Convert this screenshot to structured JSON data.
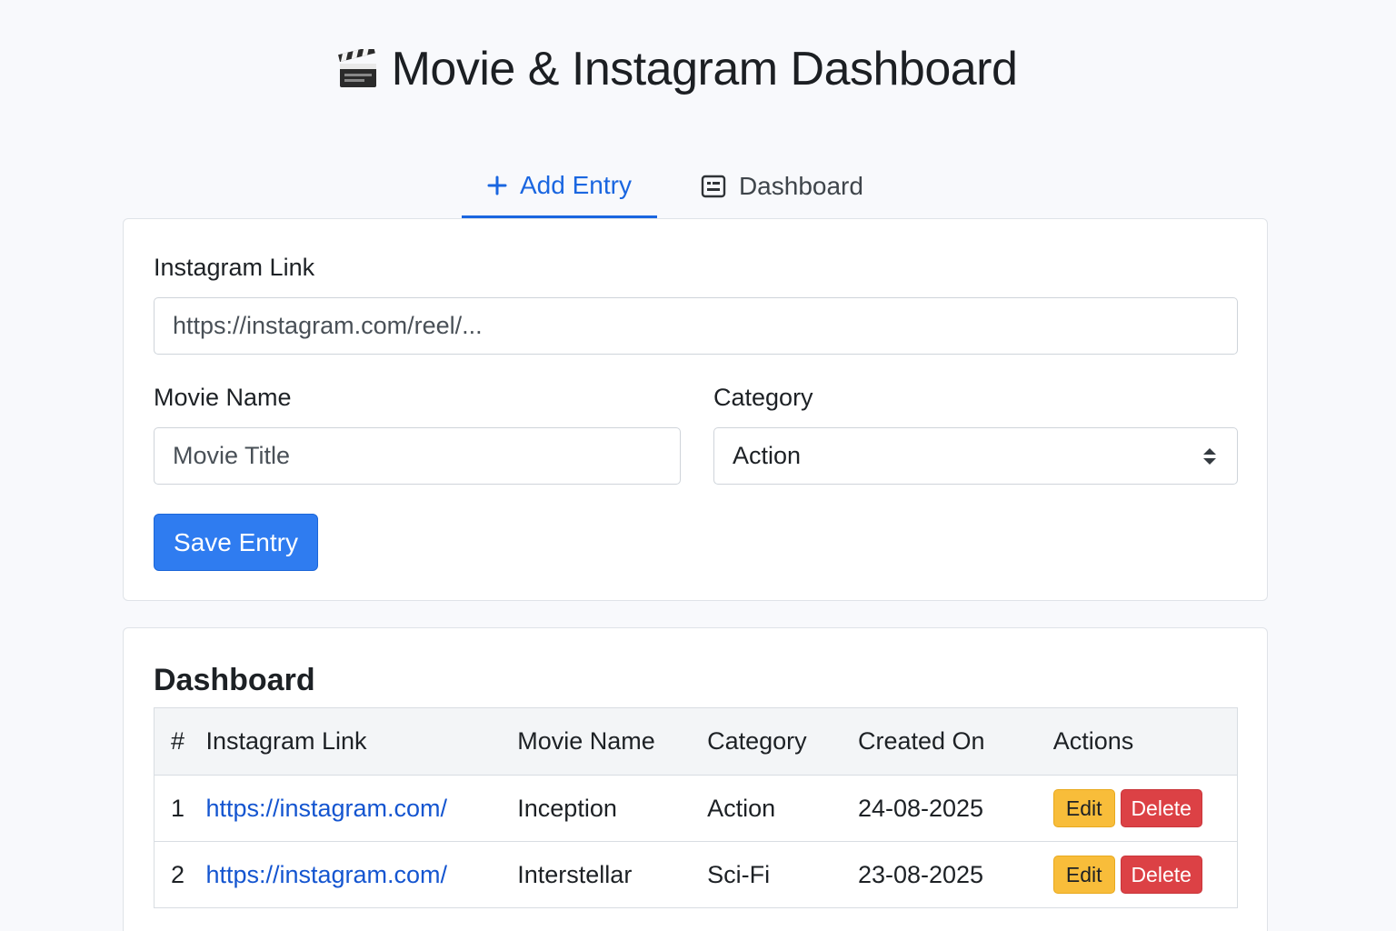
{
  "app": {
    "title": "Movie & Instagram Dashboard",
    "title_icon": "clapperboard-icon"
  },
  "tabs": [
    {
      "label": "Add Entry",
      "icon": "plus-icon",
      "active": true
    },
    {
      "label": "Dashboard",
      "icon": "dashboard-list-icon",
      "active": false
    }
  ],
  "form": {
    "instagram_label": "Instagram Link",
    "instagram_placeholder": "https://instagram.com/reel/...",
    "movie_label": "Movie Name",
    "movie_placeholder": "Movie Title",
    "category_label": "Category",
    "category_value": "Action",
    "save_label": "Save Entry"
  },
  "dashboard": {
    "title": "Dashboard",
    "columns": [
      "#",
      "Instagram Link",
      "Movie Name",
      "Category",
      "Created On",
      "Actions"
    ],
    "rows": [
      {
        "num": "1",
        "link": "https://instagram.com/",
        "movie": "Inception",
        "category": "Action",
        "created": "24-08-2025"
      },
      {
        "num": "2",
        "link": "https://instagram.com/",
        "movie": "Interstellar",
        "category": "Sci-Fi",
        "created": "23-08-2025"
      }
    ],
    "edit_label": "Edit",
    "delete_label": "Delete"
  },
  "colors": {
    "accent": "#1a66e0",
    "primary_button": "#2f7cf0",
    "edit_button": "#f8bd3a",
    "delete_button": "#dc4145",
    "link": "#1455d0"
  }
}
